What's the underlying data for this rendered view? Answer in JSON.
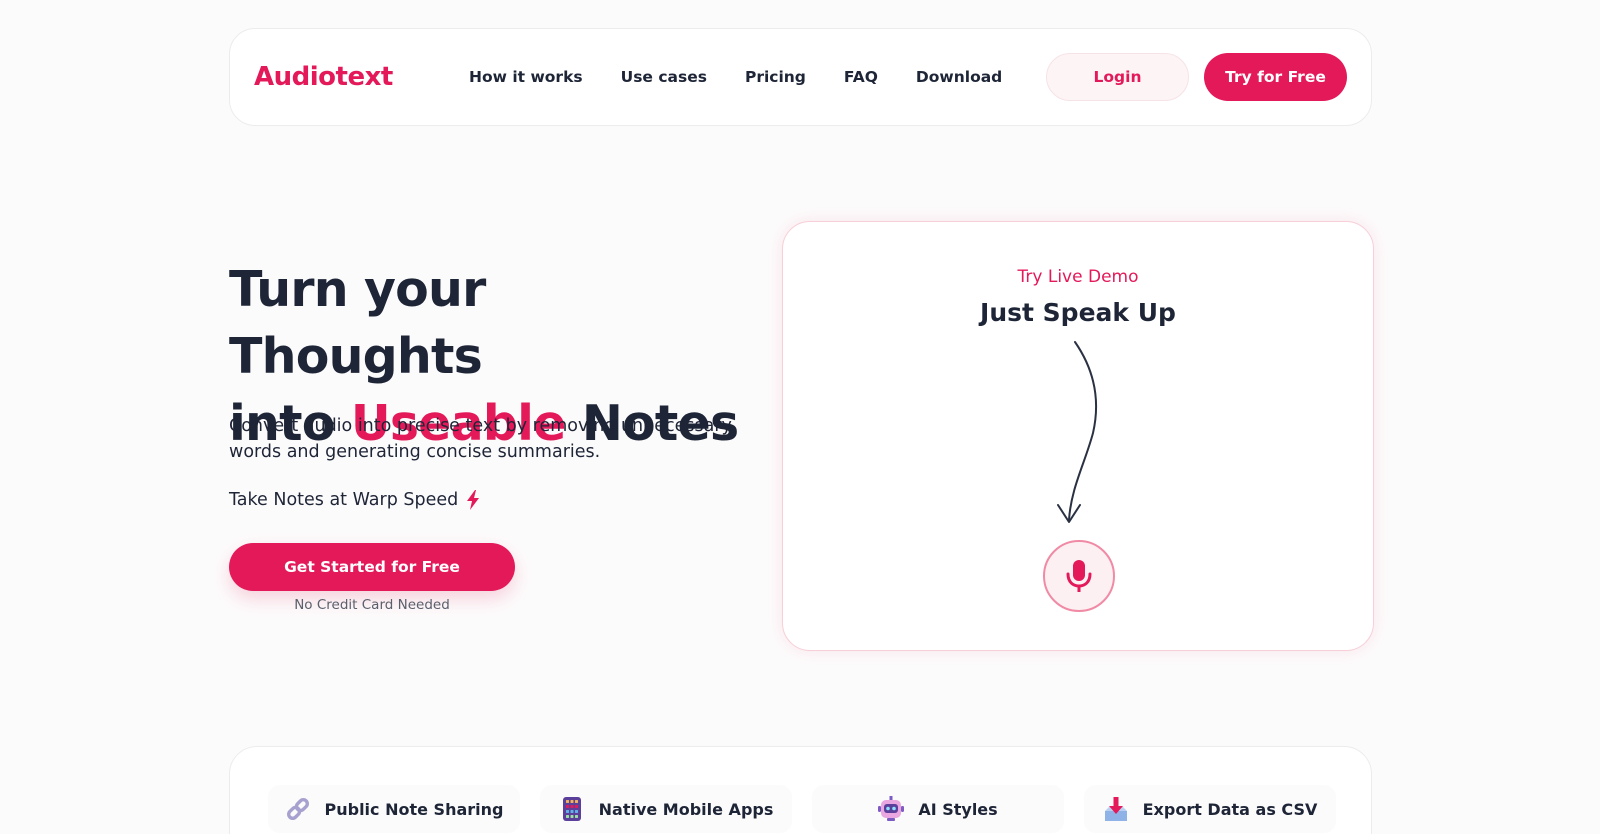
{
  "brand": {
    "logo": "Audiotext",
    "accent": "#e3195a"
  },
  "nav": {
    "links": [
      "How it works",
      "Use cases",
      "Pricing",
      "FAQ",
      "Download"
    ],
    "login_label": "Login",
    "try_label": "Try for Free"
  },
  "hero": {
    "title_line1": "Turn your Thoughts",
    "title_line2_pre": "into ",
    "title_line2_accent": "Useable",
    "title_line2_post": " Notes",
    "subtitle": "Convert audio into precise text by removing unnecessary words and generating concise summaries.",
    "warp": "Take Notes at Warp Speed",
    "warp_icon": "lightning-icon",
    "cta_label": "Get Started for Free",
    "cta_note": "No Credit Card Needed"
  },
  "demo": {
    "kicker": "Try Live Demo",
    "title": "Just Speak Up",
    "mic_icon": "microphone-icon"
  },
  "features": [
    {
      "label": "Public Note Sharing",
      "icon": "link-icon"
    },
    {
      "label": "Native Mobile Apps",
      "icon": "mobile-app-icon"
    },
    {
      "label": "AI Styles",
      "icon": "robot-icon"
    },
    {
      "label": "Export Data as CSV",
      "icon": "export-icon"
    }
  ]
}
